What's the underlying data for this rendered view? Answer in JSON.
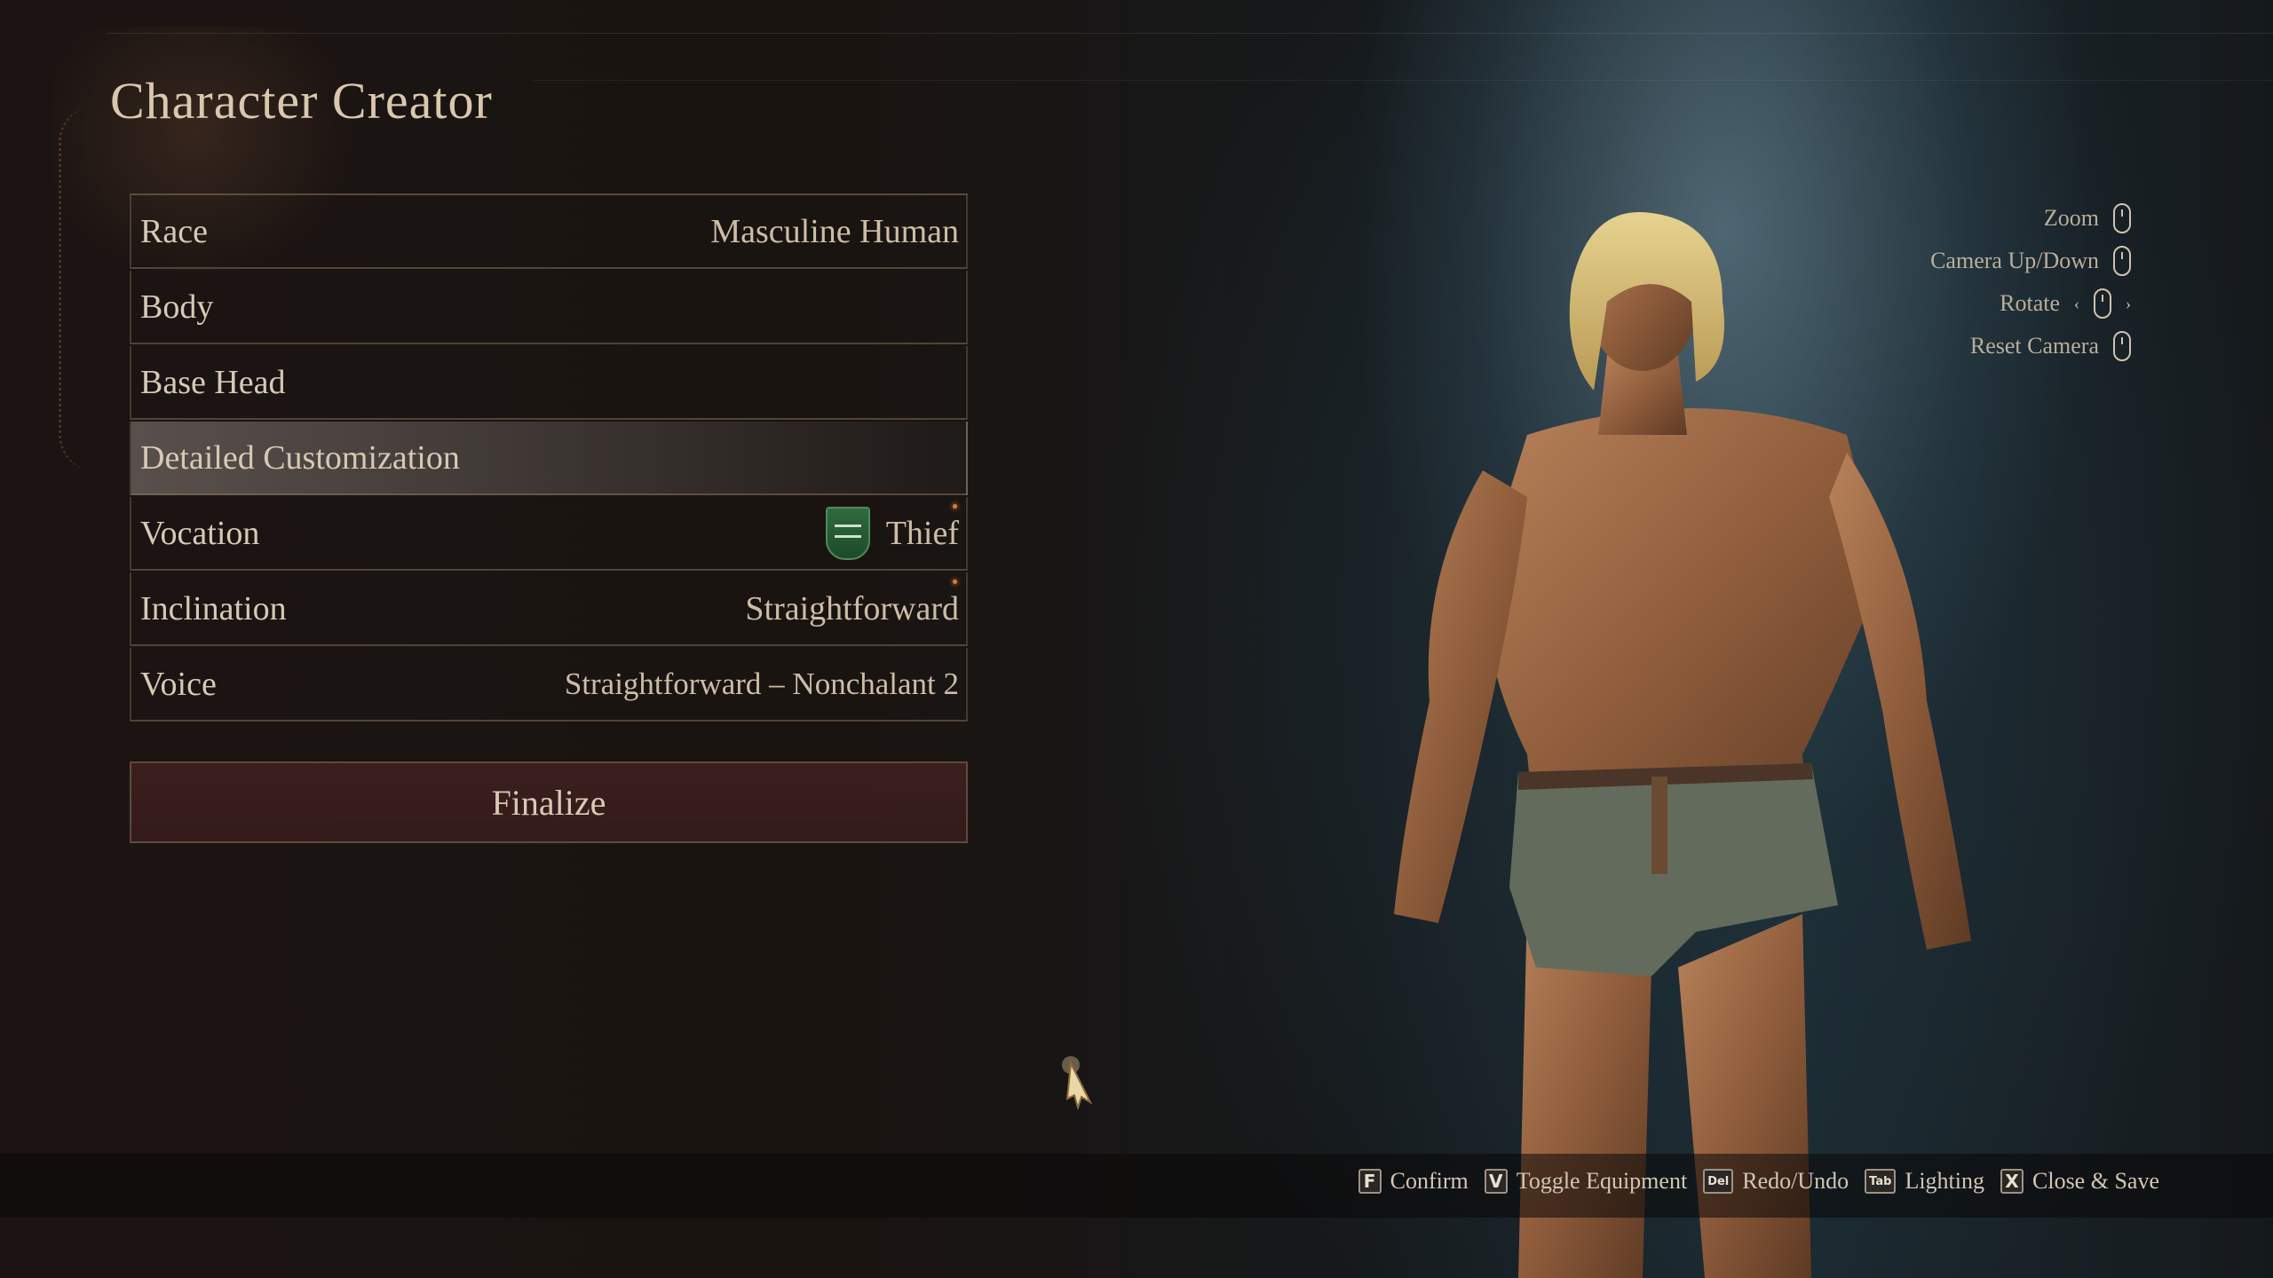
{
  "title": "Character Creator",
  "menu": [
    {
      "label": "Race",
      "value": "Masculine Human"
    },
    {
      "label": "Body",
      "value": ""
    },
    {
      "label": "Base Head",
      "value": ""
    },
    {
      "label": "Detailed Customization",
      "value": ""
    },
    {
      "label": "Vocation",
      "value": "Thief",
      "icon": "vocation-thief-icon"
    },
    {
      "label": "Inclination",
      "value": "Straightforward"
    },
    {
      "label": "Voice",
      "value": "Straightforward – Nonchalant 2"
    }
  ],
  "selected_index": 3,
  "finalize_label": "Finalize",
  "camera": {
    "zoom": "Zoom",
    "camera_updown": "Camera Up/Down",
    "rotate": "Rotate",
    "reset": "Reset Camera"
  },
  "hints": [
    {
      "key": "F",
      "label": "Confirm"
    },
    {
      "key": "V",
      "label": "Toggle Equipment"
    },
    {
      "key": "Del",
      "label": "Redo/Undo"
    },
    {
      "key": "Tab",
      "label": "Lighting"
    },
    {
      "key": "X",
      "label": "Close & Save"
    }
  ],
  "colors": {
    "accent": "#e07a2e",
    "finalize_bg": "#4a2424",
    "vocation_icon": "#2f6b3e"
  }
}
